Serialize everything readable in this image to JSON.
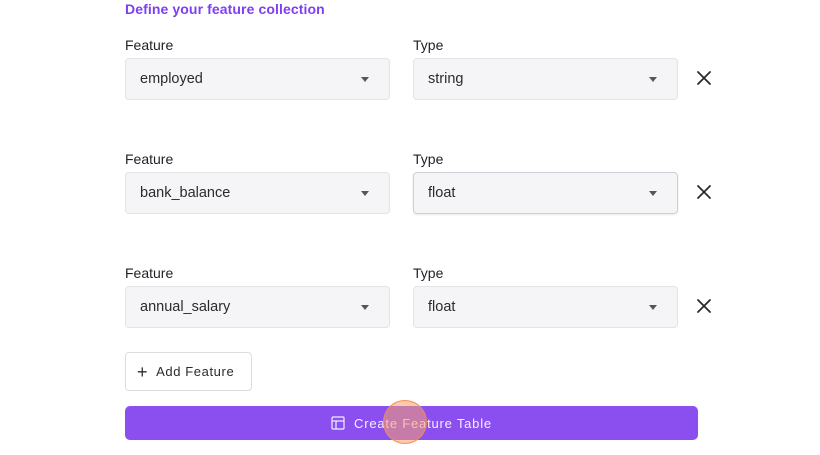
{
  "section": {
    "title": "Define your feature collection"
  },
  "labels": {
    "feature": "Feature",
    "type": "Type"
  },
  "features": [
    {
      "name": "employed",
      "type": "string"
    },
    {
      "name": "bank_balance",
      "type": "float"
    },
    {
      "name": "annual_salary",
      "type": "float"
    }
  ],
  "buttons": {
    "add_feature": "Add Feature",
    "create_table": "Create Feature Table"
  },
  "icons": {
    "remove": "close-icon",
    "add": "plus-icon",
    "create": "table-icon",
    "dropdown": "chevron-down-icon"
  },
  "colors": {
    "accent": "#7e3ff2",
    "primary_button": "#8b4ff0",
    "field_bg": "#f5f5f7",
    "click_indicator": "#faa06e"
  }
}
